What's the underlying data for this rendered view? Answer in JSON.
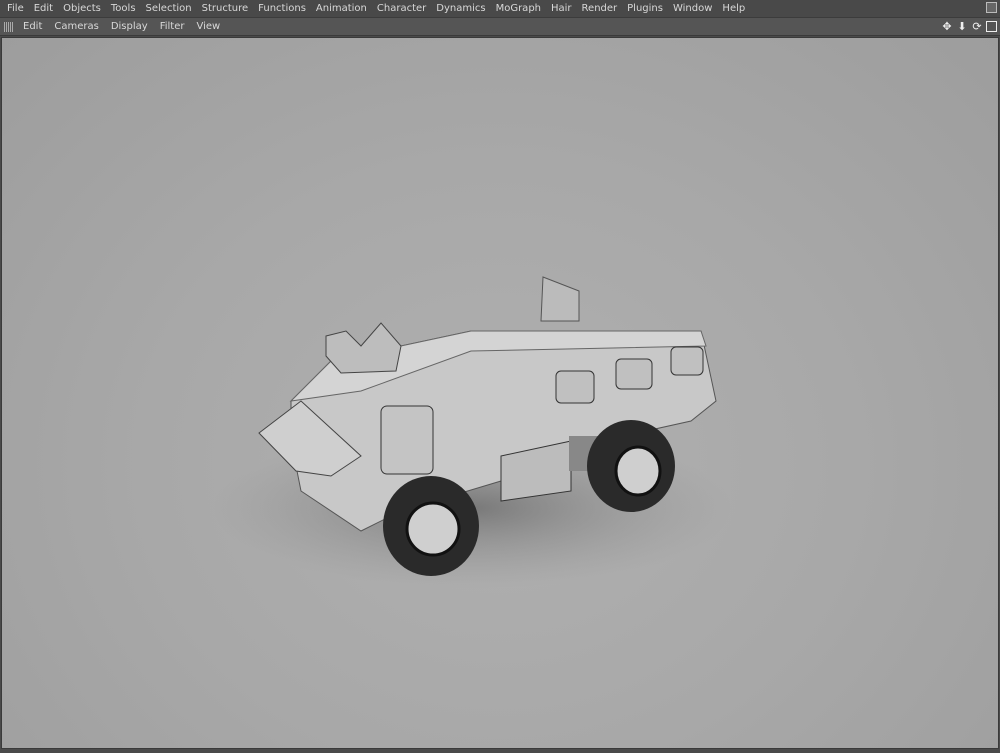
{
  "menu": [
    "File",
    "Edit",
    "Objects",
    "Tools",
    "Selection",
    "Structure",
    "Functions",
    "Animation",
    "Character",
    "Dynamics",
    "MoGraph",
    "Hair",
    "Render",
    "Plugins",
    "Window",
    "Help"
  ],
  "viewport_menu": [
    "Edit",
    "Cameras",
    "Display",
    "Filter",
    "View"
  ],
  "nav_icons": [
    "move-icon",
    "zoom-icon",
    "rotate-icon",
    "maximize-icon"
  ]
}
